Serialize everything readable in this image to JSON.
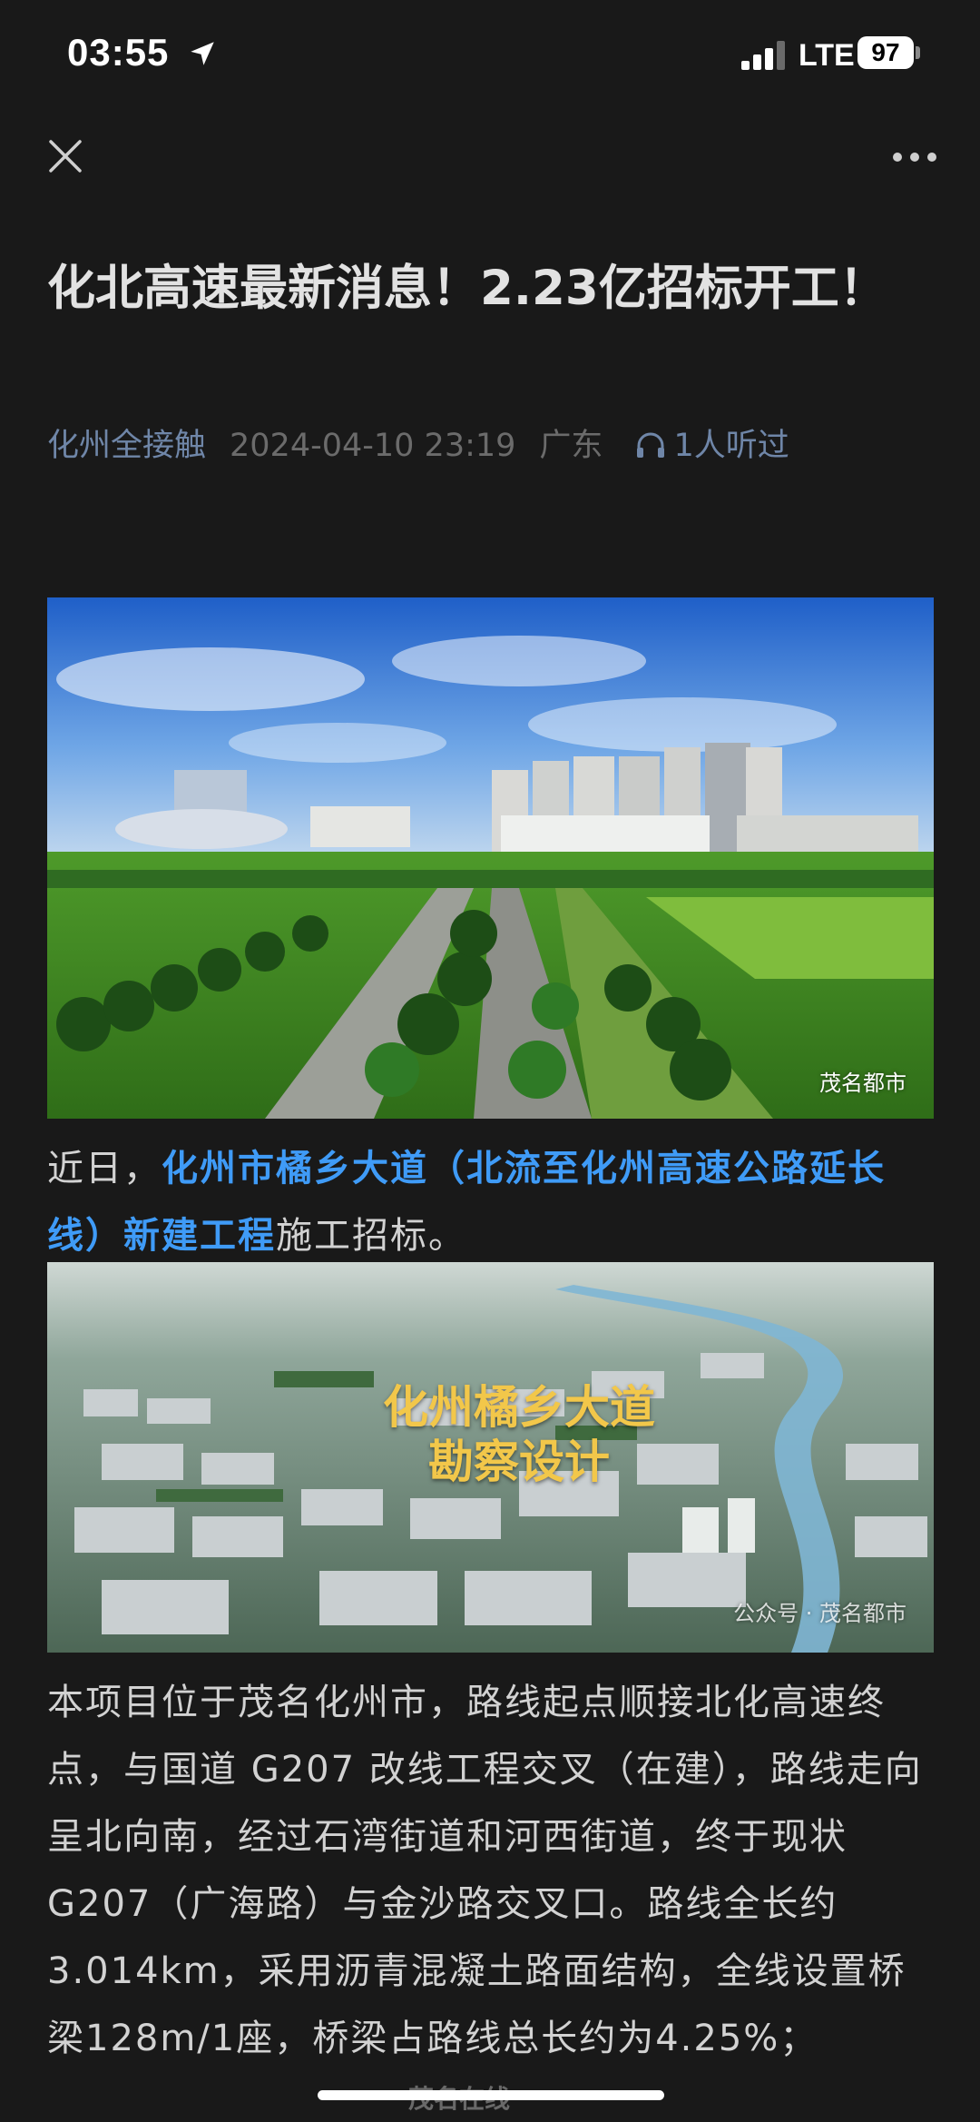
{
  "status_bar": {
    "time": "03:55",
    "network": "LTE",
    "battery": "97"
  },
  "nav": {
    "close_icon": "close-icon",
    "more_icon": "more-icon"
  },
  "article": {
    "title": "化北高速最新消息！2.23亿招标开工！",
    "meta": {
      "source": "化州全接触",
      "datetime": "2024-04-10 23:19",
      "region": "广东",
      "listen_count": "1人听过"
    },
    "image1": {
      "watermark": "茂名都市"
    },
    "paragraph1": {
      "prefix": "近日，",
      "link": "化州市橘乡大道（北流至化州高速公路延长线）新建工程",
      "suffix": "施工招标。"
    },
    "image2": {
      "overlay": "化州橘乡大道勘察设计",
      "watermark": "公众号 · 茂名都市"
    },
    "paragraph2": "本项目位于茂名化州市，路线起点顺接北化高速终点，与国道 G207 改线工程交叉（在建），路线走向呈北向南，经过石湾街道和河西街道，终于现状 G207（广海路）与金沙路交叉口。路线全长约3.014km，采用沥青混凝土路面结构，全线设置桥梁128m/1座，桥梁占路线总长约为4.25%；"
  },
  "footer": {
    "site_watermark": "茂名在线"
  },
  "colors": {
    "background": "#191919",
    "link": "#3f9bf7",
    "meta_source": "#6f86a8",
    "meta_muted": "#6b6b6b"
  }
}
